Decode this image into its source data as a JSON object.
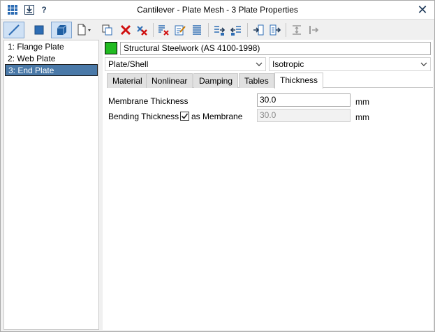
{
  "window": {
    "title": "Cantilever - Plate Mesh - 3 Plate Properties",
    "help_label": "?",
    "close_label": "✕"
  },
  "toolbar": {
    "icons": [
      "line-icon",
      "plate-icon",
      "brick-icon",
      "new-document-icon",
      "copy-icon",
      "delete-icon",
      "delete-all-icon",
      "clear-icon",
      "edit-icon",
      "list-icon",
      "import-icon",
      "export-icon",
      "insert-icon",
      "output-icon",
      "spacing-icon",
      "step-icon"
    ]
  },
  "list": {
    "items": [
      {
        "label": "1: Flange Plate"
      },
      {
        "label": "2: Web Plate"
      },
      {
        "label": "3: End Plate"
      }
    ],
    "selected_index": 2
  },
  "material": {
    "color": "#22bb22",
    "name": "Structural Steelwork (AS 4100-1998)",
    "element_type": "Plate/Shell",
    "material_model": "Isotropic"
  },
  "tabs": [
    "Material",
    "Nonlinear",
    "Damping",
    "Tables",
    "Thickness"
  ],
  "active_tab": "Thickness",
  "thickness": {
    "membrane_label": "Membrane Thickness",
    "membrane_value": "30.0",
    "membrane_unit": "mm",
    "bending_label": "Bending Thickness",
    "as_membrane_label": "as Membrane",
    "as_membrane_checked": true,
    "bending_value": "30.0",
    "bending_unit": "mm"
  }
}
